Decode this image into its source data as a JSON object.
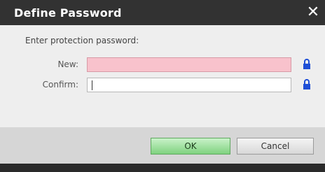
{
  "dialog": {
    "title": "Define Password",
    "close_glyph": "✕",
    "prompt": "Enter protection password:",
    "new_label": "New:",
    "new_value": "",
    "confirm_label": "Confirm:",
    "confirm_value": "",
    "ok_label": "OK",
    "cancel_label": "Cancel",
    "lock_icon": "lock-icon",
    "colors": {
      "title_bar": "#323232",
      "new_field_error": "#f8c2cc",
      "ok_green": "#7fd27f",
      "lock_blue": "#1f4fd6"
    }
  }
}
